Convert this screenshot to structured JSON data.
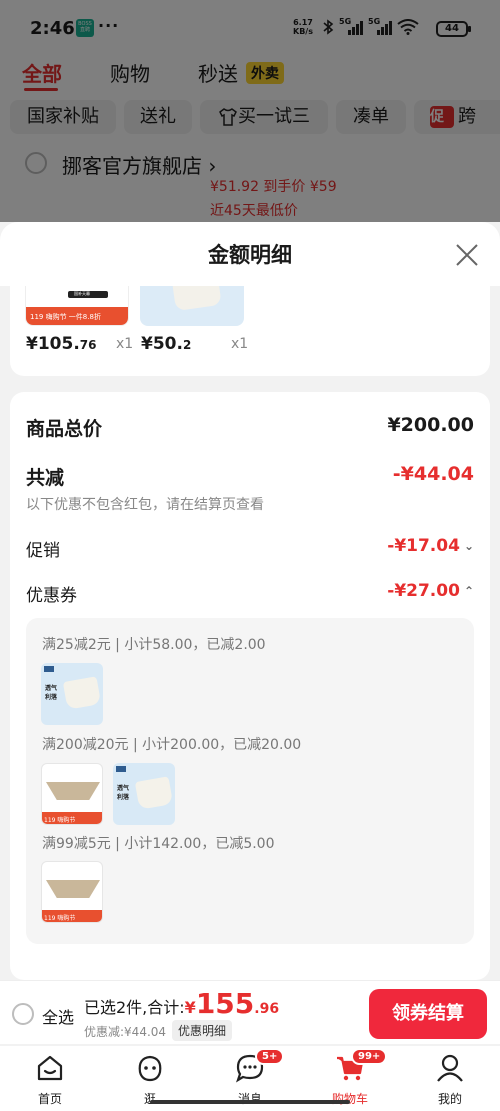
{
  "status_bar": {
    "time": "2:46",
    "boss_badge": "BOSS\n直聘",
    "dots": "···",
    "net_speed_value": "6.17",
    "net_speed_unit": "KB/s",
    "signal_tag_1": "5G",
    "signal_tag_2": "5G",
    "battery": "44"
  },
  "top_tabs": {
    "all": "全部",
    "shopping": "购物",
    "flash": "秒送",
    "waimai_badge": "外卖"
  },
  "chips": [
    "国家补贴",
    "送礼",
    "买一试三",
    "凑单",
    "跨"
  ],
  "chip_promo_badge": "促",
  "store": {
    "name": "挪客官方旗舰店",
    "arrow": "›",
    "price_text": "¥51.92 到手价   ¥59",
    "low_price_text": "近45天最低价"
  },
  "sheet": {
    "title": "金额明细",
    "products": [
      {
        "price_int": "¥105.",
        "price_dec": "76",
        "qty": "x1",
        "thumb_caption": "119   嗨购节 一件8.8折",
        "thumb_label": "国补天幕"
      },
      {
        "price_int": "¥50.",
        "price_dec": "2",
        "qty": "x1"
      }
    ],
    "summary": {
      "total_label": "商品总价",
      "total_value": "¥200.00",
      "reduce_label": "共减",
      "reduce_value": "-¥44.04",
      "note": "以下优惠不包含红包，请在结算页查看",
      "promo_label": "促销",
      "promo_value": "-¥17.04",
      "coupon_label": "优惠券",
      "coupon_value": "-¥27.00"
    },
    "coupons": [
      {
        "text": "满25减2元 | 小计58.00，已减2.00"
      },
      {
        "text": "满200减20元 | 小计200.00，已减20.00"
      },
      {
        "text": "满99减5元 | 小计142.00，已减5.00"
      }
    ],
    "thumb_text_tee": "透气\n利落",
    "thumb_text_tent": "119 嗨购节"
  },
  "checkout": {
    "select_all": "全选",
    "selected_text": "已选2件,合计:",
    "total_yen": "¥",
    "total_int": "155",
    "total_dec": ".96",
    "discount_text": "优惠减:¥44.04",
    "detail_chip": "优惠明细",
    "button": "领券结算"
  },
  "bottom_nav": {
    "items": [
      {
        "label": "首页",
        "icon": "home-icon"
      },
      {
        "label": "逛",
        "icon": "browse-icon"
      },
      {
        "label": "消息",
        "icon": "message-icon",
        "badge": "5+"
      },
      {
        "label": "购物车",
        "icon": "cart-icon",
        "badge": "99+",
        "active": true
      },
      {
        "label": "我的",
        "icon": "profile-icon"
      }
    ]
  },
  "colors": {
    "accent": "#e62e2e",
    "checkout_button": "#f0283c",
    "waimai_badge": "#ffd633"
  }
}
